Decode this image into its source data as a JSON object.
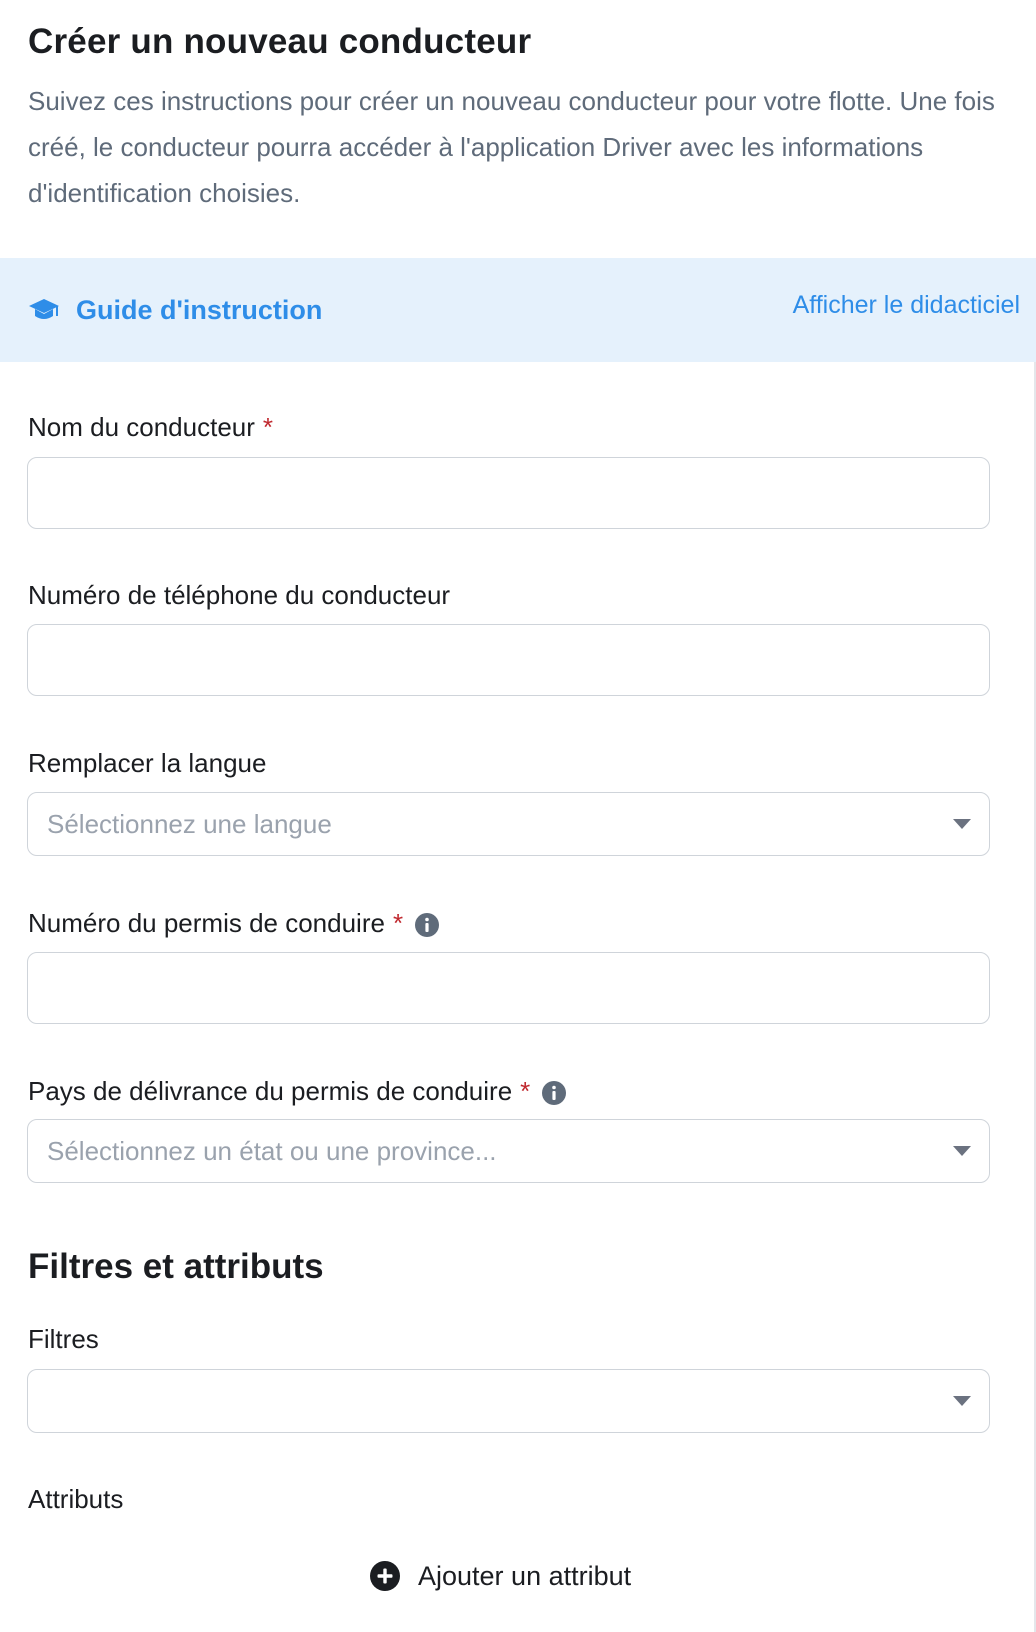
{
  "header": {
    "title": "Créer un nouveau conducteur",
    "description": "Suivez ces instructions pour créer un nouveau conducteur pour votre flotte. Une fois créé, le conducteur pourra accéder à l'application Driver avec les informations d'identification choisies."
  },
  "guide": {
    "icon": "graduation-cap-icon",
    "title": "Guide d'instruction",
    "link": "Afficher le didacticiel"
  },
  "form": {
    "name": {
      "label": "Nom du conducteur",
      "required": "*",
      "value": ""
    },
    "phone": {
      "label": "Numéro de téléphone du conducteur",
      "value": ""
    },
    "language": {
      "label": "Remplacer la langue",
      "placeholder": "Sélectionnez une langue"
    },
    "license_number": {
      "label": "Numéro du permis de conduire",
      "required": "*",
      "value": ""
    },
    "license_country": {
      "label": "Pays de délivrance du permis de conduire",
      "required": "*",
      "placeholder": "Sélectionnez un état ou une province..."
    }
  },
  "filters_section": {
    "title": "Filtres et attributs",
    "filters_label": "Filtres",
    "attributes_label": "Attributs",
    "add_attribute": "Ajouter un attribut"
  },
  "colors": {
    "accent": "#2e8de8",
    "guide_background": "#e5f1fc",
    "required": "#c0282e",
    "muted_text": "#5f6b7a"
  }
}
